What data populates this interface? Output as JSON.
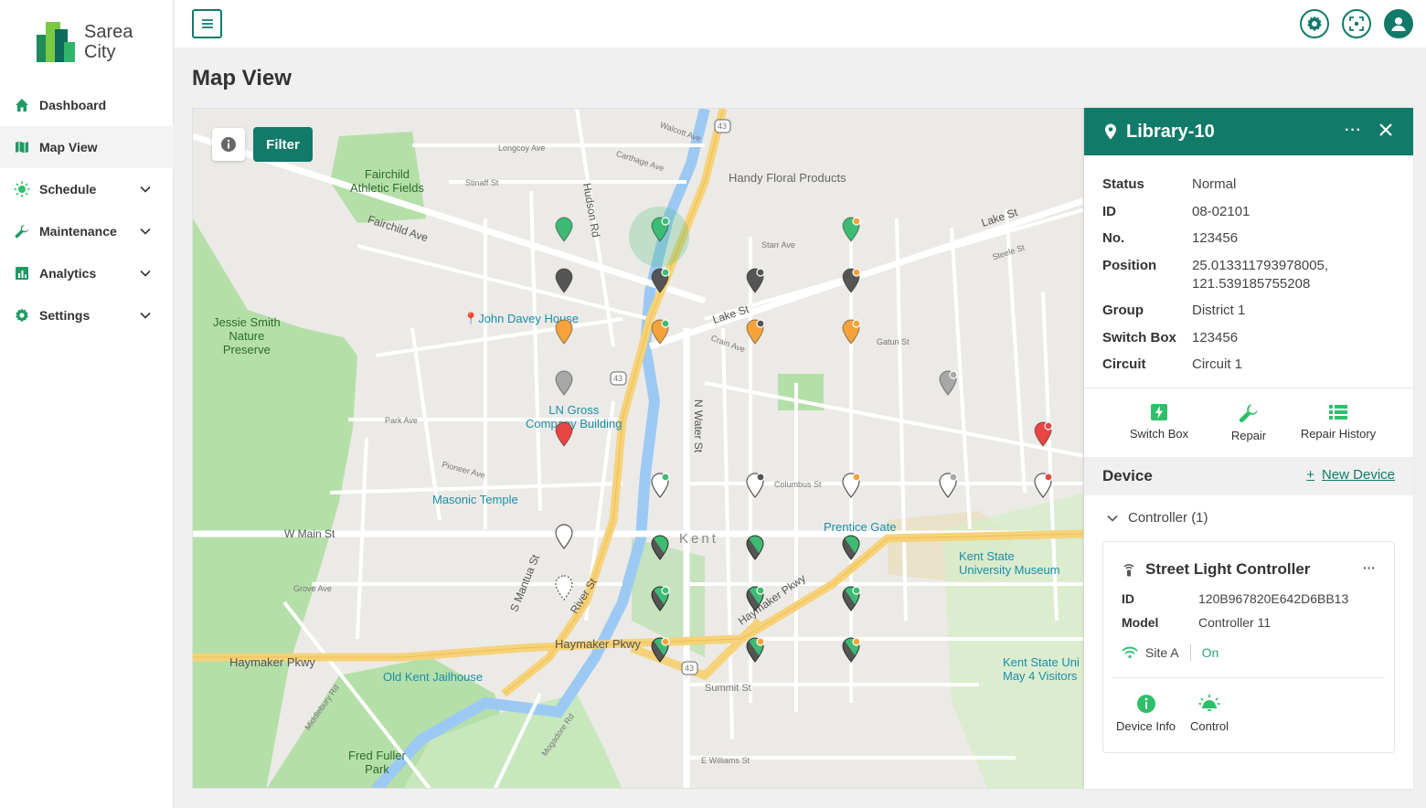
{
  "app": {
    "logo_line1": "Sarea",
    "logo_line2": "City"
  },
  "sidebar": {
    "items": [
      {
        "label": "Dashboard",
        "icon": "home-icon"
      },
      {
        "label": "Map View",
        "icon": "map-icon",
        "active": true
      },
      {
        "label": "Schedule",
        "icon": "sun-icon"
      },
      {
        "label": "Maintenance",
        "icon": "wrench-icon"
      },
      {
        "label": "Analytics",
        "icon": "chart-icon"
      },
      {
        "label": "Settings",
        "icon": "gear-icon"
      }
    ]
  },
  "page": {
    "title": "Map View"
  },
  "map": {
    "filter_label": "Filter",
    "places": {
      "fairchild": "Fairchild\nAthletic Fields",
      "jessie": "Jessie Smith\nNature\nPreserve",
      "john_davey": "John Davey House",
      "ln_gross": "LN Gross\nCompany Building",
      "masonic": "Masonic Temple",
      "handy": "Handy Floral Products",
      "prentice": "Prentice Gate",
      "kent_museum": "Kent State\nUniversity Museum",
      "old_kent": "Old Kent Jailhouse",
      "fred_fuller": "Fred Fuller\nPark",
      "kent_visitors": "Kent State Uni\nMay 4 Visitors",
      "kent": "Kent"
    },
    "roads": {
      "fairchild_ave": "Fairchild Ave",
      "lake_st": "Lake St",
      "lake_st2": "Lake St",
      "w_main": "W Main St",
      "haymaker": "Haymaker Pkwy",
      "haymaker2": "Haymaker Pkwy",
      "haymaker3": "Haymaker Pkwy",
      "s_mantua": "S Mantua St",
      "river_st": "River St",
      "n_water": "N Water St",
      "hudson": "Hudson Rd",
      "park_ave": "Park Ave",
      "grove_ave": "Grove Ave",
      "summit": "Summit St",
      "pioneer": "Pioneer Ave",
      "columbus": "Columbus St",
      "longcoy": "Longcoy Ave",
      "carthage": "Carthage Ave",
      "walcott": "Walcott Ave",
      "stinaff": "Stinaff St",
      "starr": "Starr Ave",
      "crain": "Crain Ave",
      "gatun": "Gatun St",
      "middlebury": "Middlebury Rd",
      "mogadore": "Mogadore Rd",
      "e_williams": "E Williams St",
      "steele": "Steele St",
      "route43a": "43",
      "route43b": "43",
      "route43c": "43"
    }
  },
  "panel": {
    "title": "Library-10",
    "props": [
      {
        "key": "Status",
        "value": "Normal"
      },
      {
        "key": "ID",
        "value": "08-02101"
      },
      {
        "key": "No.",
        "value": "123456"
      },
      {
        "key": "Position",
        "value": "25.013311793978005,\n121.539185755208"
      },
      {
        "key": "Group",
        "value": "District 1"
      },
      {
        "key": "Switch Box",
        "value": "123456"
      },
      {
        "key": "Circuit",
        "value": "Circuit 1"
      }
    ],
    "actions": [
      {
        "label": "Switch Box",
        "icon": "switch-box-icon"
      },
      {
        "label": "Repair",
        "icon": "wrench-icon"
      },
      {
        "label": "Repair History",
        "icon": "list-icon"
      }
    ],
    "device_title": "Device",
    "new_device": "New Device",
    "controller_group": "Controller (1)",
    "card": {
      "title": "Street Light Controller",
      "id_label": "ID",
      "id_value": "120B967820E642D6BB13",
      "model_label": "Model",
      "model_value": "Controller 11",
      "site": "Site A",
      "state": "On",
      "device_info": "Device Info",
      "control": "Control"
    }
  },
  "colors": {
    "brand": "#117a69",
    "pin_green": "#3dbb74",
    "pin_dark": "#555555",
    "pin_orange": "#f5a33a",
    "pin_gray": "#a8a8a8",
    "pin_red": "#e84545",
    "pin_white": "#ffffff"
  }
}
